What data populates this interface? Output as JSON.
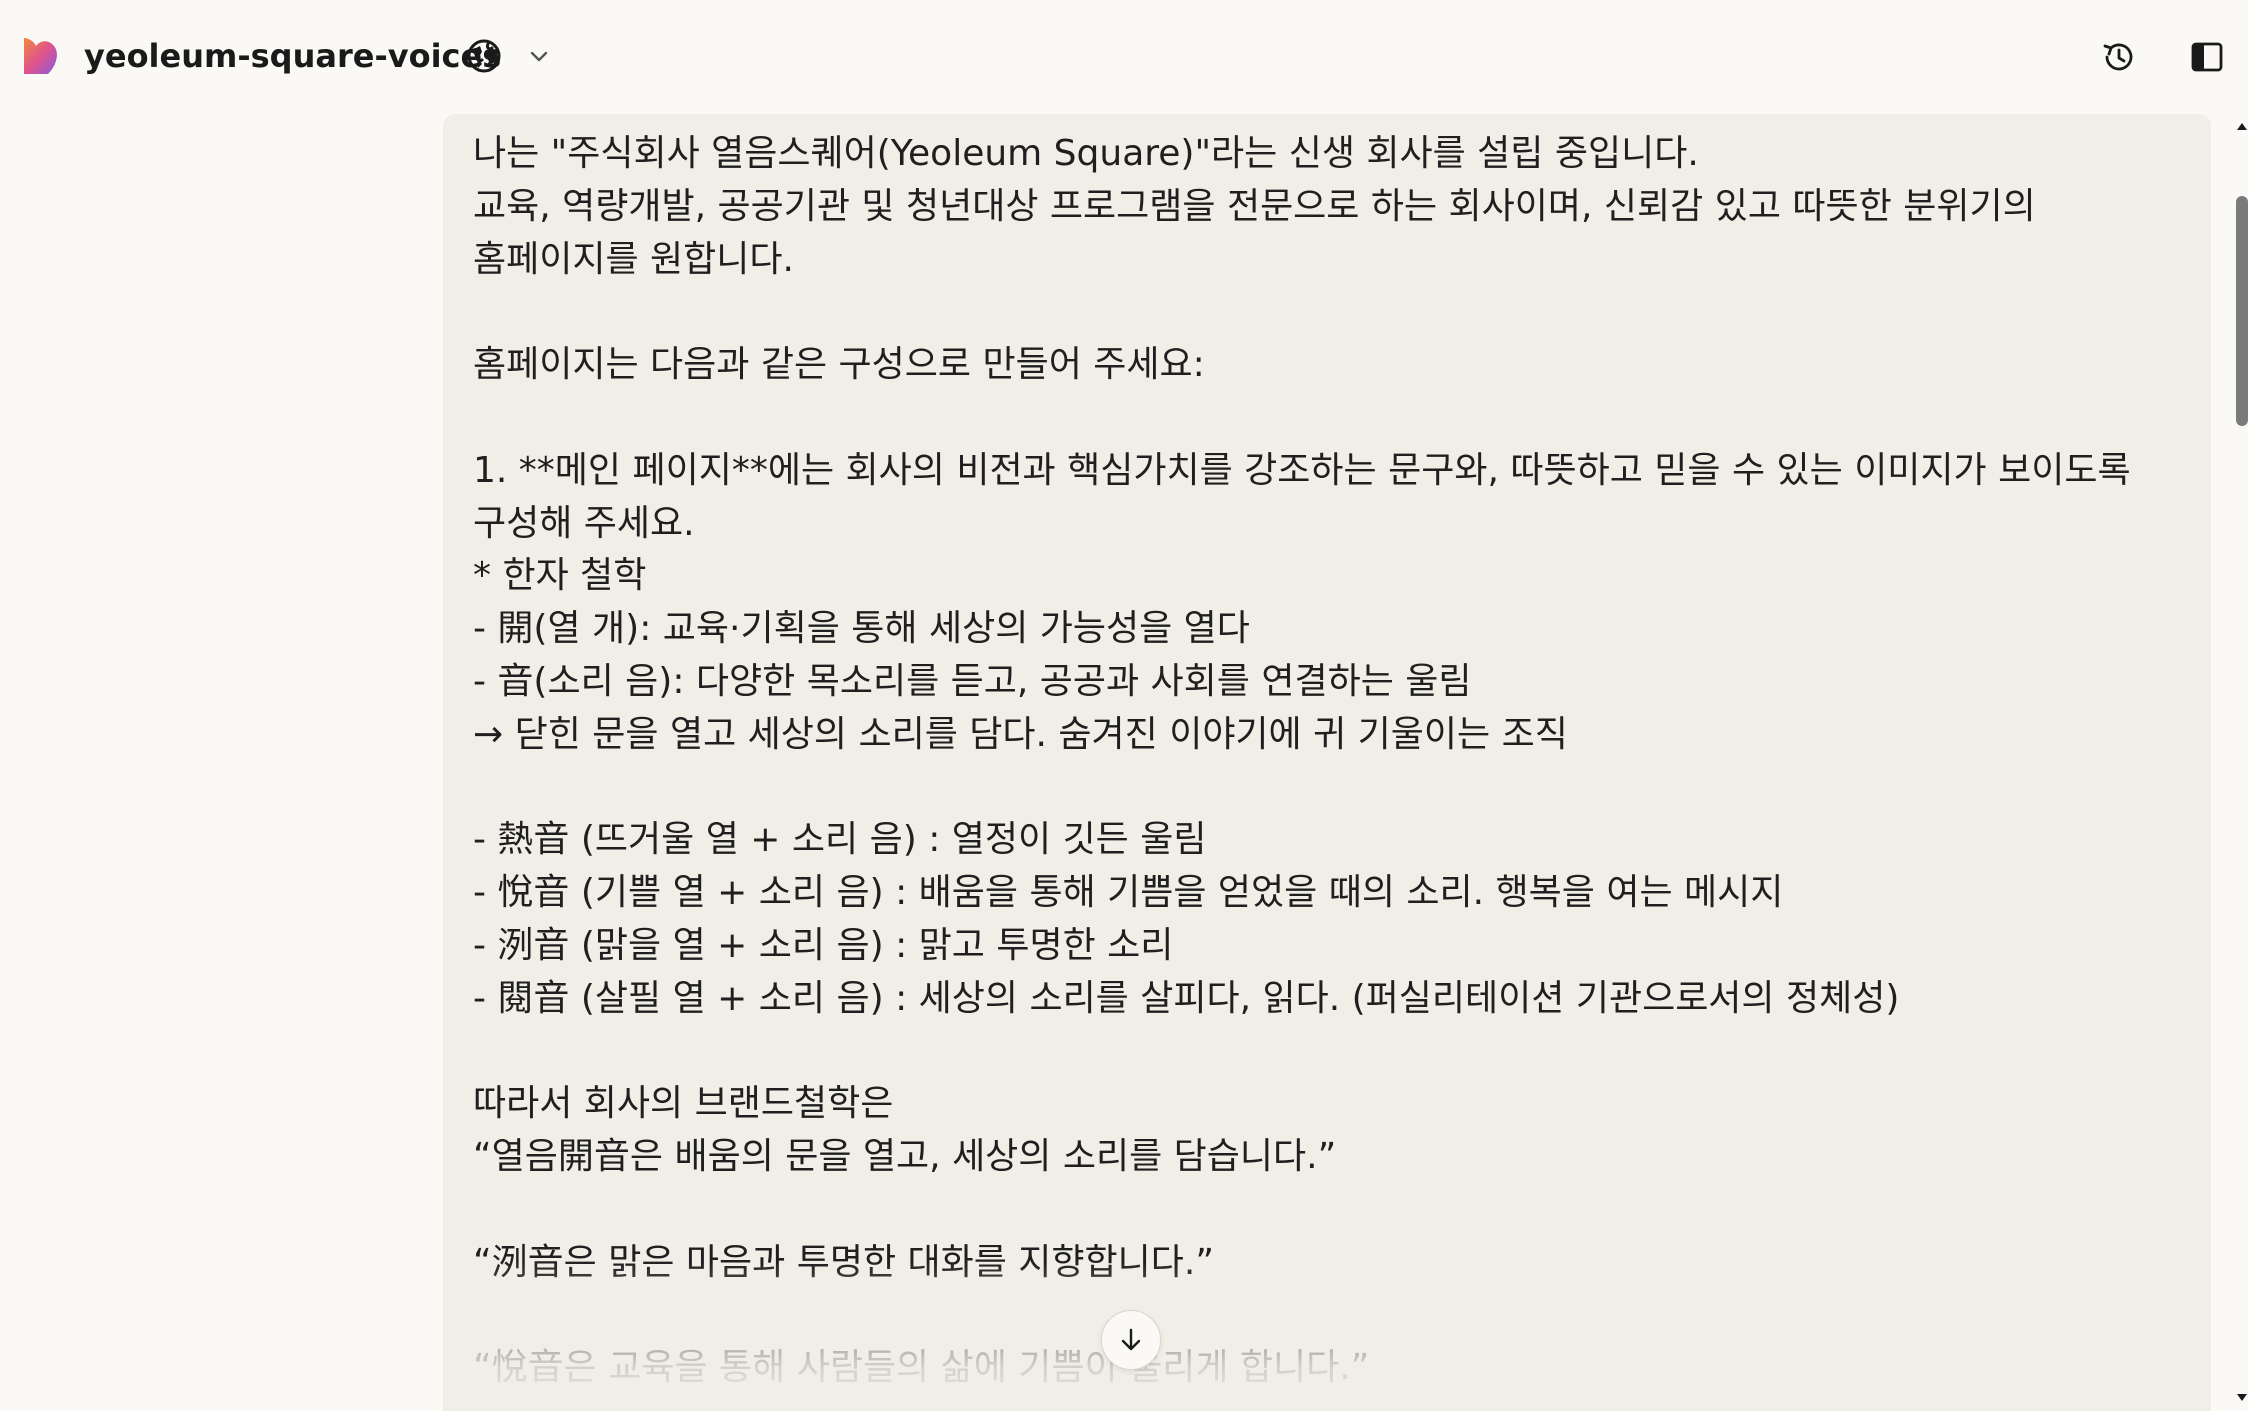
{
  "header": {
    "project_title": "yeoleum-square-voices",
    "icons": {
      "logo": "claude-logo-icon",
      "visibility": "globe-icon",
      "menu": "chevron-down-icon",
      "history": "history-icon",
      "sidebar": "sidebar-toggle-icon"
    }
  },
  "message": {
    "text": "나는 \"주식회사 열음스퀘어(Yeoleum Square)\"라는 신생 회사를 설립 중입니다.\n교육, 역량개발, 공공기관 및 청년대상 프로그램을 전문으로 하는 회사이며, 신뢰감 있고 따뜻한 분위기의 홈페이지를 원합니다.\n\n홈페이지는 다음과 같은 구성으로 만들어 주세요:\n\n1. **메인 페이지**에는 회사의 비전과 핵심가치를 강조하는 문구와, 따뜻하고 믿을 수 있는 이미지가 보이도록 구성해 주세요.\n* 한자 철학\n- 開(열 개): 교육·기획을 통해 세상의 가능성을 열다\n- 音(소리 음): 다양한 목소리를 듣고, 공공과 사회를 연결하는 울림\n→ 닫힌 문을 열고 세상의 소리를 담다. 숨겨진 이야기에 귀 기울이는 조직\n\n- 熱音 (뜨거울 열 + 소리 음) : 열정이 깃든 울림\n- 悅音 (기쁠 열 + 소리 음) : 배움을 통해 기쁨을 얻었을 때의 소리. 행복을 여는 메시지\n- 洌音 (맑을 열 + 소리 음) : 맑고 투명한 소리\n- 閱音 (살필 열 + 소리 음) : 세상의 소리를 살피다, 읽다. (퍼실리테이션 기관으로서의 정체성)\n\n따라서 회사의 브랜드철학은\n“열음開音은 배움의 문을 열고, 세상의 소리를 담습니다.”\n\n“洌音은 맑은 마음과 투명한 대화를 지향합니다.”\n\n“悅音은 교육을 통해 사람들의 삶에 기쁨이 울리게 합니다.”"
  },
  "colors": {
    "background": "#faf9f5",
    "card": "#f0eee6",
    "text": "#1f1f1f",
    "logo_orange": "#e8743b",
    "logo_pink": "#d94f8a",
    "logo_purple": "#7b5cd6"
  }
}
